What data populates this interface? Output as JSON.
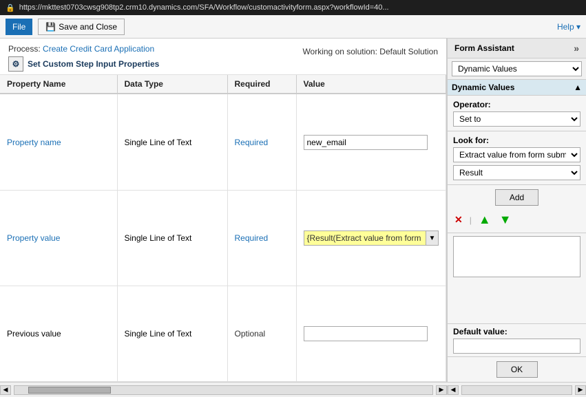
{
  "titlebar": {
    "url": "https://mkttest0703cwsg908tp2.crm10.dynamics.com/SFA/Workflow/customactivityform.aspx?workflowId=40...",
    "lock_icon": "🔒"
  },
  "toolbar": {
    "file_label": "File",
    "save_close_label": "Save and Close",
    "save_icon": "💾",
    "help_label": "Help ▾"
  },
  "header": {
    "process_label": "Process:",
    "process_link": "Create Credit Card Application",
    "page_title": "Set Custom Step Input Properties",
    "working_solution": "Working on solution: Default Solution"
  },
  "table": {
    "columns": [
      "Property Name",
      "Data Type",
      "Required",
      "Value"
    ],
    "rows": [
      {
        "property_name": "Property name",
        "data_type": "Single Line of Text",
        "required": "Required",
        "value": "new_email",
        "value_type": "text"
      },
      {
        "property_name": "Property value",
        "data_type": "Single Line of Text",
        "required": "Required",
        "value": "{Result(Extract value from form",
        "value_type": "dynamic"
      },
      {
        "property_name": "Previous value",
        "data_type": "Single Line of Text",
        "required": "Optional",
        "value": "",
        "value_type": "text"
      }
    ]
  },
  "form_assistant": {
    "title": "Form Assistant",
    "expand_icon": "»",
    "dropdown_value": "Dynamic Values",
    "section_title": "Dynamic Values",
    "collapse_icon": "▲",
    "operator": {
      "label": "Operator:",
      "value": "Set to",
      "options": [
        "Set to"
      ]
    },
    "look_for": {
      "label": "Look for:",
      "value": "Extract value from form submission",
      "options": [
        "Extract value from form submission"
      ],
      "result_value": "Result",
      "result_options": [
        "Result"
      ]
    },
    "add_button": "Add",
    "actions": {
      "delete_icon": "✕",
      "up_icon": "▲",
      "down_icon": "▼"
    },
    "default_value": {
      "label": "Default value:",
      "value": ""
    },
    "ok_button": "OK"
  }
}
